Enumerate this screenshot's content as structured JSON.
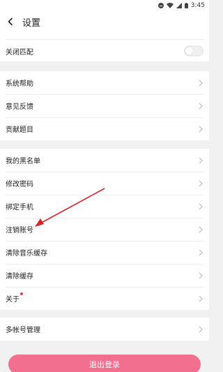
{
  "status_bar": {
    "time": "3:45"
  },
  "header": {
    "title": "设置"
  },
  "close_match": {
    "label": "关闭匹配",
    "enabled": false
  },
  "group_help": [
    {
      "label": "系统帮助"
    },
    {
      "label": "意见反馈"
    },
    {
      "label": "贡献题目"
    }
  ],
  "group_account": [
    {
      "label": "我的黑名单"
    },
    {
      "label": "修改密码"
    },
    {
      "label": "绑定手机"
    },
    {
      "label": "注销账号"
    },
    {
      "label": "清除音乐缓存"
    },
    {
      "label": "清除缓存"
    },
    {
      "label": "关于"
    }
  ],
  "group_multi": [
    {
      "label": "多帐号管理"
    }
  ],
  "logout": {
    "label": "退出登录"
  },
  "colors": {
    "accent": "#f36f8f",
    "annotation_arrow": "#d9262a",
    "badge": "#e94141"
  }
}
